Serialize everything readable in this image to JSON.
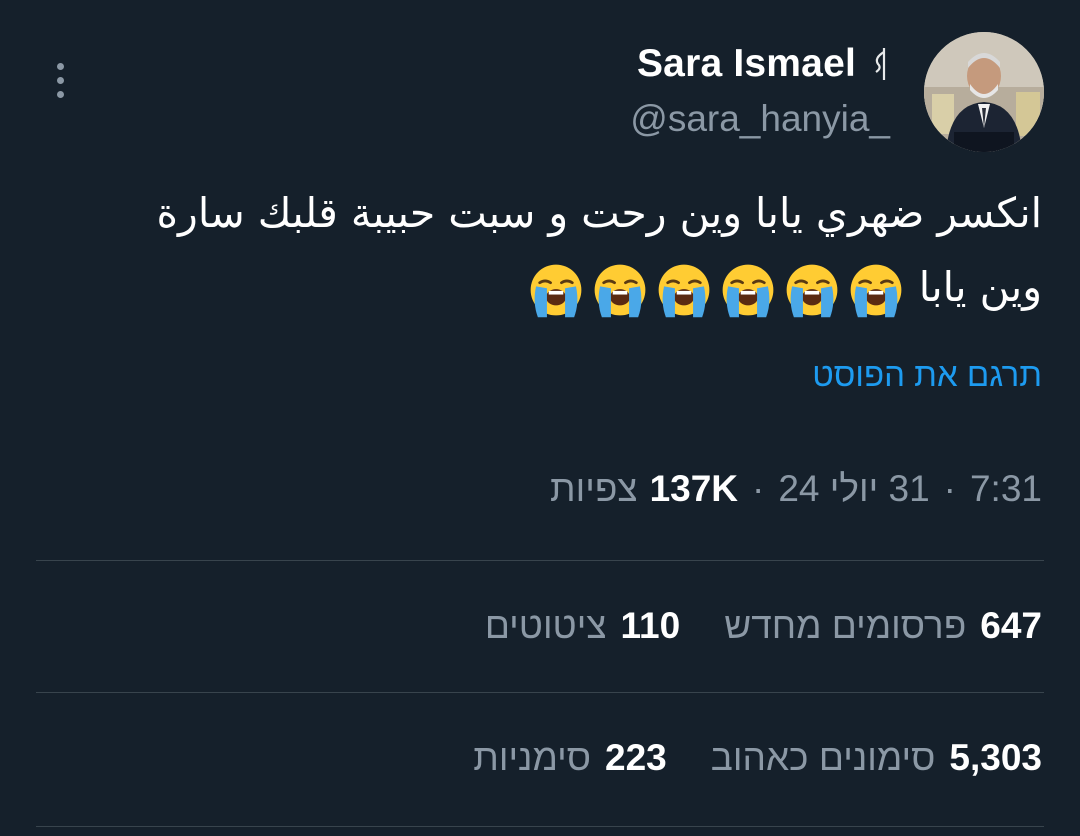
{
  "author": {
    "display_name": "Sara Ismael",
    "handle": "@sara_hanyia_"
  },
  "tweet": {
    "line1": "انكسر ضهري يابا وين رحت و سبت حبيبة قلبك سارة",
    "line2": "وين يابا",
    "emoji": "loudly-crying-face",
    "emoji_count": 6
  },
  "translate_label": "תרגם את הפוסט",
  "meta": {
    "time": "7:31",
    "date": "31 יולי 24",
    "views_count": "137K",
    "views_label": "צפיות",
    "separator": "·"
  },
  "stats_row1": [
    {
      "count": "647",
      "label": "פרסומים מחדש"
    },
    {
      "count": "110",
      "label": "ציטוטים"
    }
  ],
  "stats_row2": [
    {
      "count": "5,303",
      "label": "סימונים כאהוב"
    },
    {
      "count": "223",
      "label": "סימניות"
    }
  ],
  "colors": {
    "background": "#15202b",
    "text_primary": "#ffffff",
    "text_secondary": "#8b98a5",
    "link": "#1d9bf0",
    "divider": "#38444d"
  }
}
